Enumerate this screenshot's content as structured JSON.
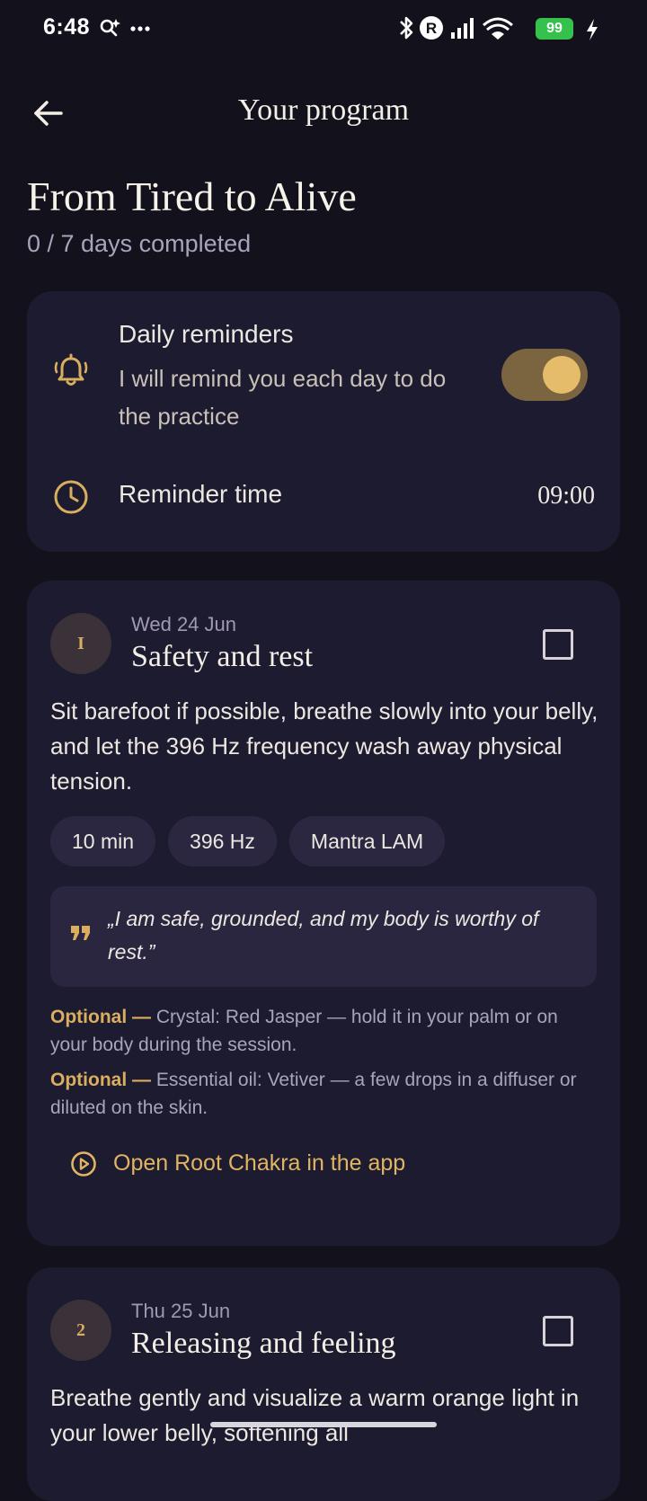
{
  "status_bar": {
    "time": "6:48",
    "battery": "99",
    "icons": [
      "search-sparkle-icon",
      "more-dots-icon",
      "bluetooth-icon",
      "r-badge-icon",
      "signal-icon",
      "wifi-icon",
      "battery-icon",
      "charging-icon"
    ]
  },
  "header": {
    "title": "Your program"
  },
  "program": {
    "title": "From Tired to Alive",
    "progress": "0 / 7 days completed"
  },
  "reminders": {
    "title": "Daily reminders",
    "description": "I will remind you each day to do the practice",
    "enabled": true,
    "time_label": "Reminder time",
    "time_value": "09:00"
  },
  "days": [
    {
      "badge": "I",
      "date": "Wed 24 Jun",
      "title": "Safety and rest",
      "description": "Sit barefoot if possible, breathe slowly into your belly, and let the 396 Hz frequency wash away physical tension.",
      "chips": [
        "10 min",
        "396 Hz",
        "Mantra LAM"
      ],
      "quote": "„I am safe, grounded, and my body is worthy of rest.”",
      "optional_label": "Optional —",
      "optional_1": "Crystal: Red Jasper — hold it in your palm or on your body during the session.",
      "optional_2": "Essential oil: Vetiver — a few drops in a diffuser or diluted on the skin.",
      "open_label": "Open Root Chakra in the app",
      "completed": false
    },
    {
      "badge": "2",
      "date": "Thu 25 Jun",
      "title": "Releasing and feeling",
      "description": "Breathe gently and visualize a warm orange light in your lower belly, softening all",
      "completed": false
    }
  ],
  "colors": {
    "background": "#12111c",
    "card": "#1d1b2f",
    "accent": "#e0b464"
  }
}
